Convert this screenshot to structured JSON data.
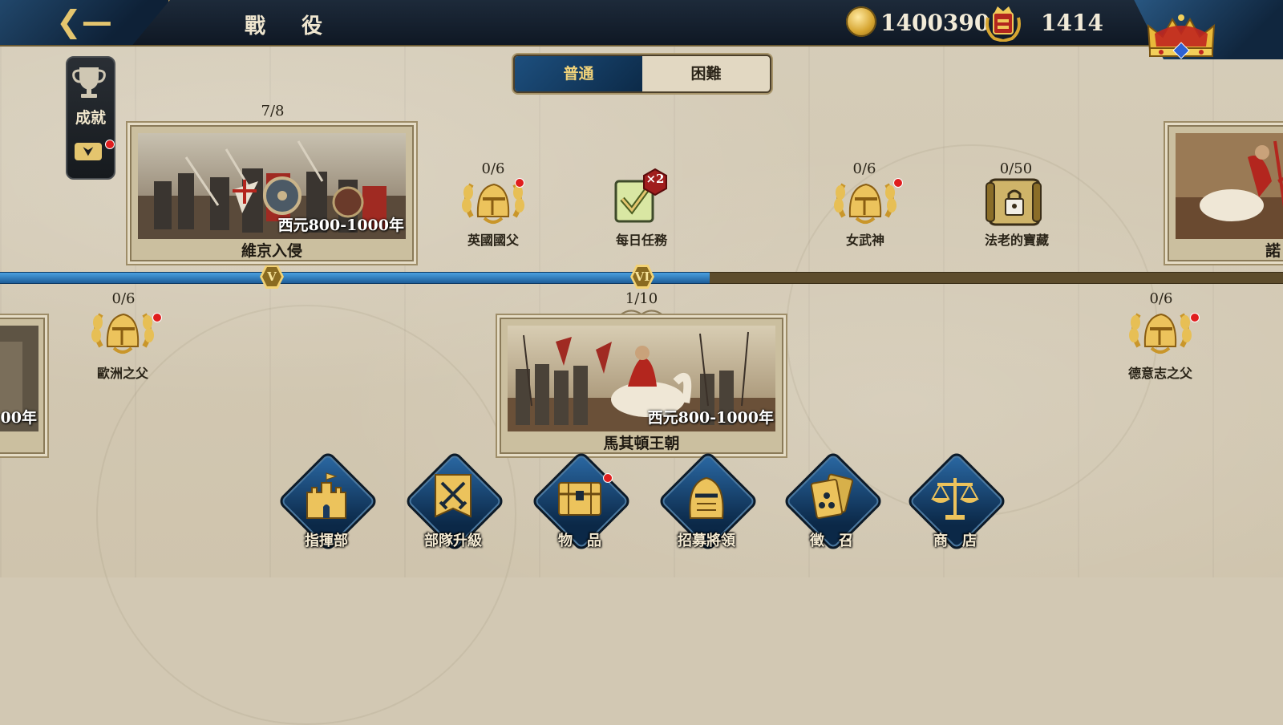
{
  "header": {
    "title": "戰 役",
    "gold": "1400390",
    "honor": "1414"
  },
  "mode_tabs": {
    "normal": "普通",
    "hard": "困難",
    "selected": "普通"
  },
  "achievement": {
    "label": "成就"
  },
  "timeline": {
    "markers": [
      "V",
      "VI"
    ],
    "fill_fraction": 0.553
  },
  "chapters": [
    {
      "name": "維京入侵",
      "era": "西元800-1000年",
      "progress": "7/8"
    },
    {
      "name": "馬其頓王朝",
      "era": "西元800-1000年",
      "progress": "1/10"
    },
    {
      "name": "諾",
      "era": "",
      "progress": ""
    },
    {
      "name": "",
      "era": "00年",
      "progress": ""
    }
  ],
  "nodes": [
    {
      "name": "英國國父",
      "progress": "0/6",
      "icon": "helmet-laurel-icon",
      "alert": true
    },
    {
      "name": "每日任務",
      "progress": "",
      "icon": "daily-task-icon",
      "badge": "×2",
      "alert": false
    },
    {
      "name": "女武神",
      "progress": "0/6",
      "icon": "helmet-laurel-icon",
      "alert": true
    },
    {
      "name": "法老的寶藏",
      "progress": "0/50",
      "icon": "locked-scroll-icon",
      "alert": false
    },
    {
      "name": "歐洲之父",
      "progress": "0/6",
      "icon": "helmet-laurel-icon",
      "alert": true
    },
    {
      "name": "德意志之父",
      "progress": "0/6",
      "icon": "helmet-laurel-icon",
      "alert": true
    }
  ],
  "menu": [
    {
      "label": "指揮部",
      "icon": "castle-icon"
    },
    {
      "label": "部隊升級",
      "icon": "crossed-swords-banner-icon"
    },
    {
      "label": "物　品",
      "icon": "treasure-chest-icon"
    },
    {
      "label": "招募將領",
      "icon": "knight-helmet-icon"
    },
    {
      "label": "徵　召",
      "icon": "cards-icon"
    },
    {
      "label": "商　店",
      "icon": "scales-icon"
    }
  ],
  "colors": {
    "accent_gold": "#e4c56e",
    "tab_blue": "#1d4f7e",
    "track_blue": "#2f7fc4",
    "track_brown": "#5d4c2c",
    "alert_red": "#e01e1e"
  }
}
